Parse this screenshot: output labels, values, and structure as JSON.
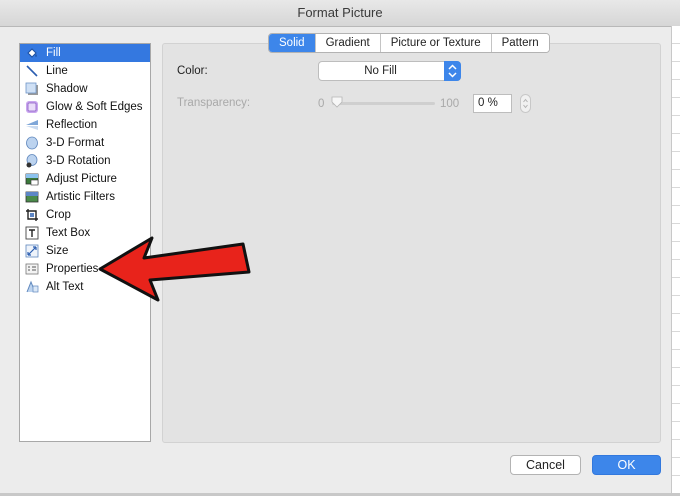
{
  "window": {
    "title": "Format Picture"
  },
  "sidebar": {
    "items": [
      {
        "label": "Fill",
        "icon": "fill-bucket-icon",
        "selected": true
      },
      {
        "label": "Line",
        "icon": "line-icon"
      },
      {
        "label": "Shadow",
        "icon": "shadow-icon"
      },
      {
        "label": "Glow & Soft Edges",
        "icon": "glow-icon"
      },
      {
        "label": "Reflection",
        "icon": "reflection-icon"
      },
      {
        "label": "3-D Format",
        "icon": "3d-format-icon"
      },
      {
        "label": "3-D Rotation",
        "icon": "3d-rotation-icon"
      },
      {
        "label": "Adjust Picture",
        "icon": "adjust-picture-icon"
      },
      {
        "label": "Artistic Filters",
        "icon": "artistic-filters-icon"
      },
      {
        "label": "Crop",
        "icon": "crop-icon"
      },
      {
        "label": "Text Box",
        "icon": "text-box-icon"
      },
      {
        "label": "Size",
        "icon": "size-icon"
      },
      {
        "label": "Properties",
        "icon": "properties-icon"
      },
      {
        "label": "Alt Text",
        "icon": "alt-text-icon"
      }
    ]
  },
  "tabs": [
    {
      "label": "Solid",
      "active": true
    },
    {
      "label": "Gradient"
    },
    {
      "label": "Picture or Texture"
    },
    {
      "label": "Pattern"
    }
  ],
  "fill": {
    "color_label": "Color:",
    "color_value": "No Fill",
    "transparency_label": "Transparency:",
    "slider_min": "0",
    "slider_max": "100",
    "transparency_value": "0 %"
  },
  "buttons": {
    "cancel": "Cancel",
    "ok": "OK"
  },
  "colors": {
    "accent": "#3d86ea",
    "selection": "#3478e0",
    "annotation_arrow": "#e8231b"
  }
}
